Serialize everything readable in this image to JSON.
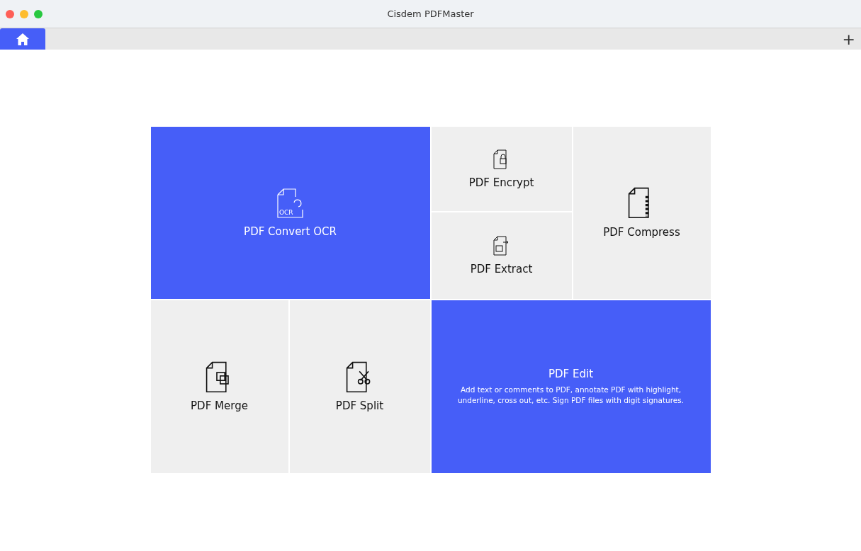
{
  "window": {
    "title": "Cisdem PDFMaster"
  },
  "tabs": [
    {
      "kind": "home",
      "selected": true
    }
  ],
  "new_tab": "+",
  "tiles": [
    {
      "kind": "ocr",
      "title": "PDF Convert OCR",
      "icon_text": "OCR",
      "highlighted": true
    },
    {
      "kind": "encrypt",
      "title": "PDF Encrypt",
      "highlighted": false
    },
    {
      "kind": "compress",
      "title": "PDF Compress",
      "highlighted": false
    },
    {
      "kind": "extract",
      "title": "PDF Extract",
      "highlighted": false
    },
    {
      "kind": "merge",
      "title": "PDF Merge",
      "highlighted": false
    },
    {
      "kind": "split",
      "title": "PDF Split",
      "highlighted": false
    },
    {
      "kind": "edit",
      "title": "PDF Edit",
      "description": "Add text or comments to PDF, annotate PDF with highlight, underline, cross out, etc. Sign PDF files with digit signatures.",
      "highlighted": true
    }
  ]
}
